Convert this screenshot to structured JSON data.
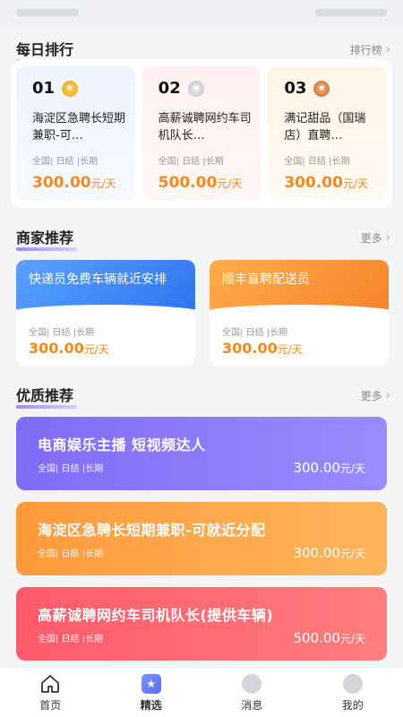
{
  "daily_rank": {
    "title": "每日排行",
    "more": "排行榜",
    "items": [
      {
        "no": "01",
        "title": "海淀区急聘长短期兼职-可…",
        "tags": "全国| 日结 |长期",
        "price": "300.00",
        "unit": "元/天"
      },
      {
        "no": "02",
        "title": "高薪诚聘网约车司机队长…",
        "tags": "全国| 日结 |长期",
        "price": "500.00",
        "unit": "元/天"
      },
      {
        "no": "03",
        "title": "满记甜品（国瑞店）直聘…",
        "tags": "全国| 日结 |长期",
        "price": "300.00",
        "unit": "元/天"
      }
    ]
  },
  "merchant": {
    "title": "商家推荐",
    "more": "更多",
    "items": [
      {
        "title": "快递员免费车辆就近安排",
        "tags": "全国| 日结 |长期",
        "price": "300.00",
        "unit": "元/天"
      },
      {
        "title": "顺丰直聘配送员",
        "tags": "全国| 日结 |长期",
        "price": "300.00",
        "unit": "元/天"
      }
    ]
  },
  "quality": {
    "title": "优质推荐",
    "more": "更多",
    "items": [
      {
        "title": "电商娱乐主播 短视频达人",
        "tags": "全国| 日结 |长期",
        "price": "300.00",
        "unit": "元/天"
      },
      {
        "title": "海淀区急聘长短期兼职-可就近分配",
        "tags": "全国| 日结 |长期",
        "price": "300.00",
        "unit": "元/天"
      },
      {
        "title": "高薪诚聘网约车司机队长(提供车辆)",
        "tags": "全国| 日结 |长期",
        "price": "500.00",
        "unit": "元/天"
      }
    ]
  },
  "tabbar": {
    "tabs": [
      {
        "label": "首页",
        "icon": "home-icon"
      },
      {
        "label": "精选",
        "icon": "star-icon"
      },
      {
        "label": "消息",
        "icon": "message-icon"
      },
      {
        "label": "我的",
        "icon": "user-icon"
      }
    ],
    "active_index": 1
  },
  "colors": {
    "accent_purple": "#7f6cf6",
    "price_orange": "#f08a1c",
    "merchant_blue": "#2f73f0",
    "merchant_orange": "#f5822a",
    "quality_orange": "#ff9a3c",
    "quality_red": "#ff5a6a"
  }
}
